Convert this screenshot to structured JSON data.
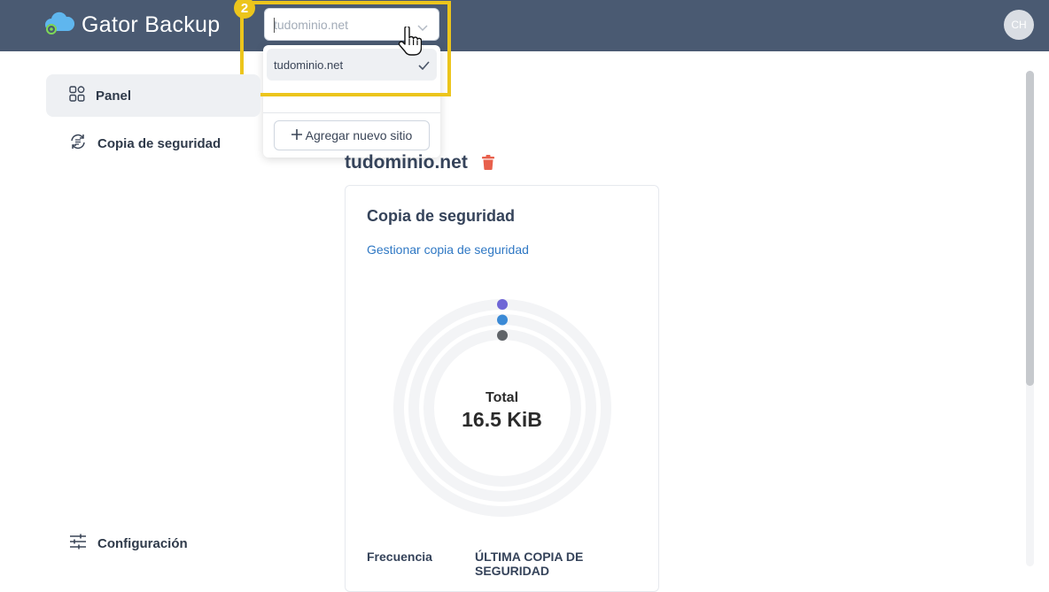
{
  "app": {
    "name": "Gator Backup"
  },
  "user": {
    "initials": "CH"
  },
  "site_selector": {
    "placeholder": "tudominio.net",
    "options": [
      {
        "label": "tudominio.net",
        "selected": true
      }
    ],
    "add_site_label": "Agregar nuevo sitio"
  },
  "tutorial": {
    "step": "2",
    "highlight_color": "#ecc51c"
  },
  "sidebar": {
    "items": [
      {
        "label": "Panel",
        "icon": "dashboard-icon",
        "active": true
      },
      {
        "label": "Copia de seguridad",
        "icon": "backup-sync-icon",
        "active": false
      }
    ],
    "settings_label": "Configuración"
  },
  "main": {
    "site_title": "tudominio.net",
    "card": {
      "title": "Copia de seguridad",
      "manage_link": "Gestionar copia de seguridad",
      "total_label": "Total",
      "total_value": "16.5 KiB",
      "frequency_label": "Frecuencia",
      "last_backup_label": "ÚLTIMA COPIA DE SEGURIDAD"
    }
  },
  "colors": {
    "topbar": "#4a5a72",
    "accent_link": "#2f78c4",
    "delete": "#e8604c",
    "dot_purple": "#6f66d6",
    "dot_blue": "#3b8ad6",
    "dot_gray": "#5f6368"
  }
}
